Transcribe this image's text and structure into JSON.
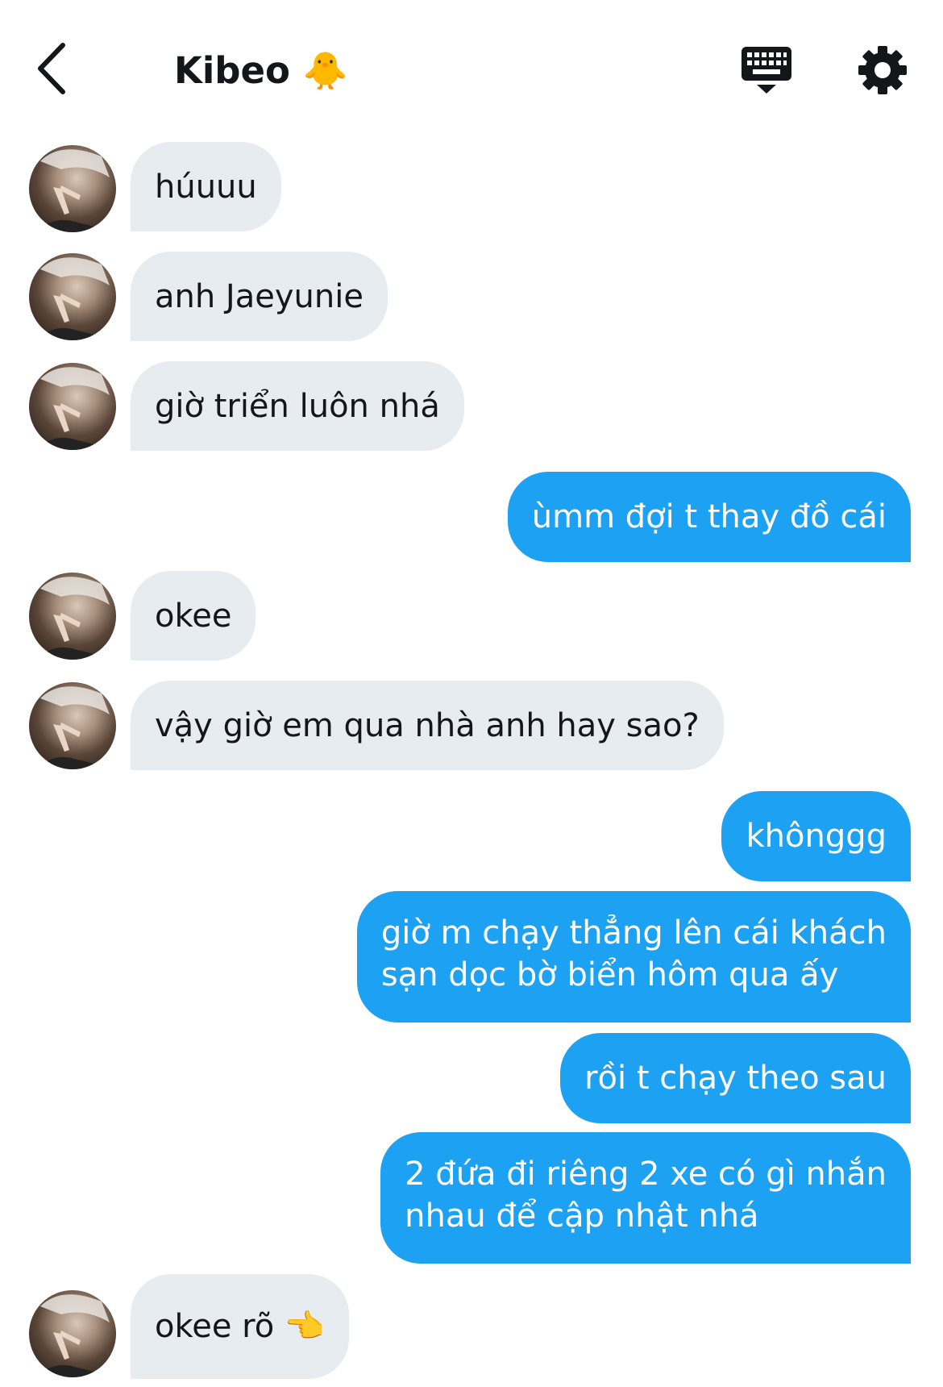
{
  "header": {
    "title": "Kibeo 🐥"
  },
  "messages": [
    {
      "side": "in",
      "text": "húuuu"
    },
    {
      "side": "in",
      "text": "anh Jaeyunie"
    },
    {
      "side": "in",
      "text": "giờ triển luôn nhá"
    },
    {
      "side": "out",
      "text": "ùmm đợi t thay đồ cái"
    },
    {
      "side": "in",
      "text": "okee"
    },
    {
      "side": "in",
      "text": "vậy giờ em qua nhà anh hay sao?"
    },
    {
      "side": "out",
      "text": "khônggg"
    },
    {
      "side": "out",
      "lines": [
        "giờ m chạy thẳng lên cái khách",
        "sạn dọc bờ biển hôm qua ấy"
      ]
    },
    {
      "side": "out",
      "text": "rồi t chạy theo sau"
    },
    {
      "side": "out",
      "lines": [
        "2 đứa đi riêng 2 xe có gì nhắn",
        "nhau để cập nhật nhá"
      ]
    },
    {
      "side": "in",
      "text": "okee rõ 👈"
    }
  ],
  "colors": {
    "incoming_bubble": "#e6ecf0",
    "outgoing_bubble": "#1da1f2",
    "text_dark": "#14171a"
  },
  "icons": {
    "back": "chevron-left-icon",
    "keyboard": "keyboard-icon",
    "settings": "gear-icon"
  }
}
